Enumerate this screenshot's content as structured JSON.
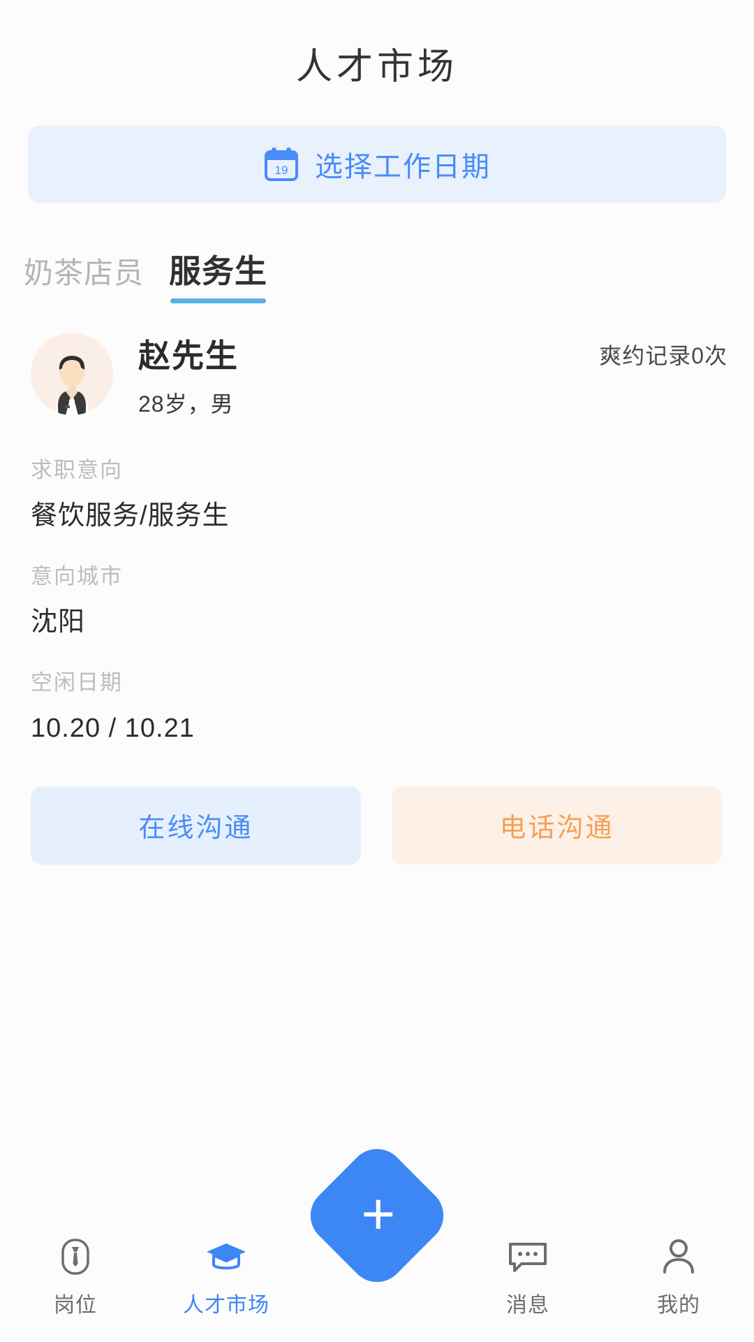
{
  "header": {
    "title": "人才市场"
  },
  "date_picker": {
    "label": "选择工作日期",
    "icon": "calendar-icon",
    "icon_day": "19",
    "accent": "#4a8cf7",
    "background": "#e8f1fc"
  },
  "tabs": [
    {
      "label": "奶茶店员",
      "active": false
    },
    {
      "label": "服务生",
      "active": true
    }
  ],
  "tab_underline_color": "#5bb0e0",
  "candidate": {
    "avatar": "avatar-person-icon",
    "name": "赵先生",
    "subtitle": "28岁，男",
    "no_show_record": "爽约记录0次",
    "fields": [
      {
        "label": "求职意向",
        "value": "餐饮服务/服务生"
      },
      {
        "label": "意向城市",
        "value": "沈阳"
      },
      {
        "label": "空闲日期",
        "value": "10.20 / 10.21"
      }
    ],
    "actions": [
      {
        "label": "在线沟通",
        "style": "online",
        "color": "#4a8cf7",
        "background": "#e6f0fc"
      },
      {
        "label": "电话沟通",
        "style": "phone",
        "color": "#f2a158",
        "background": "#fdf0e6"
      }
    ]
  },
  "bottom_nav": {
    "items": [
      {
        "label": "岗位",
        "icon": "tie-badge-icon",
        "active": false
      },
      {
        "label": "人才市场",
        "icon": "graduation-cap-icon",
        "active": true
      },
      {
        "label": "消息",
        "icon": "chat-bubble-icon",
        "active": false
      },
      {
        "label": "我的",
        "icon": "person-icon",
        "active": false
      }
    ],
    "fab": {
      "icon": "plus-icon",
      "glyph": "+",
      "color": "#3d86f5"
    },
    "active_color": "#3d86f5",
    "inactive_color": "#6d6d6d"
  }
}
